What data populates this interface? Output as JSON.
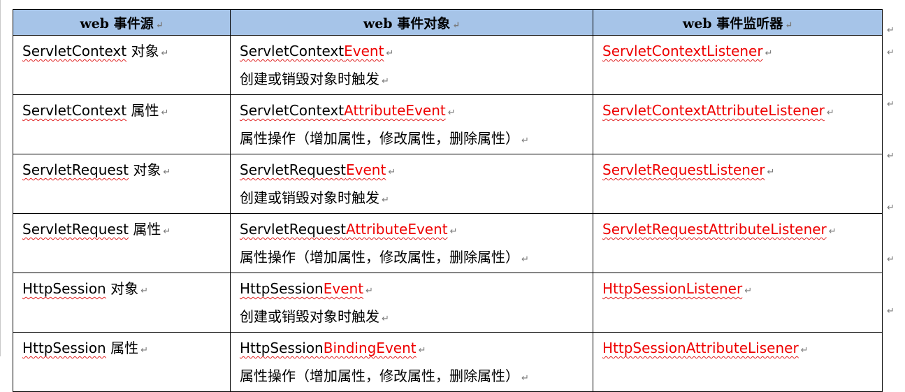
{
  "table": {
    "headers": [
      "web 事件源",
      "web 事件对象",
      "web 事件监听器"
    ],
    "rows": [
      {
        "source": "ServletContext",
        "source_suffix": "对象",
        "event_prefix": "ServletContext",
        "event_suffix": "Event",
        "description": "创建或销毁对象时触发",
        "listener": "ServletContextListener"
      },
      {
        "source": "ServletContext",
        "source_suffix": "属性",
        "event_prefix": "ServletContext",
        "event_suffix": "AttributeEvent",
        "description": "属性操作（增加属性，修改属性，删除属性）",
        "listener": "ServletContextAttributeListener"
      },
      {
        "source": "ServletRequest",
        "source_suffix": "对象",
        "event_prefix": "ServletRequest",
        "event_suffix": "Event",
        "description": "创建或销毁对象时触发",
        "listener": "ServletRequestListener"
      },
      {
        "source": "ServletRequest",
        "source_suffix": "属性",
        "event_prefix": "ServletRequest",
        "event_suffix": "AttributeEvent",
        "description": "属性操作（增加属性，修改属性，删除属性）",
        "listener": "ServletRequestAttributeListener"
      },
      {
        "source": "HttpSession",
        "source_suffix": "对象",
        "event_prefix": "HttpSession",
        "event_suffix": "Event",
        "description": "创建或销毁对象时触发",
        "listener": "HttpSessionListener"
      },
      {
        "source": "HttpSession",
        "source_suffix": "属性",
        "event_prefix": "HttpSession",
        "event_suffix": "BindingEvent",
        "description": "属性操作（增加属性，修改属性，删除属性）",
        "listener": "HttpSessionAttributeLisener"
      }
    ]
  },
  "marks": {
    "paragraph": "↵"
  },
  "colors": {
    "header_bg": "#a6c4e8",
    "event_red": "#ee0000",
    "spell_underline": "#e02020"
  }
}
